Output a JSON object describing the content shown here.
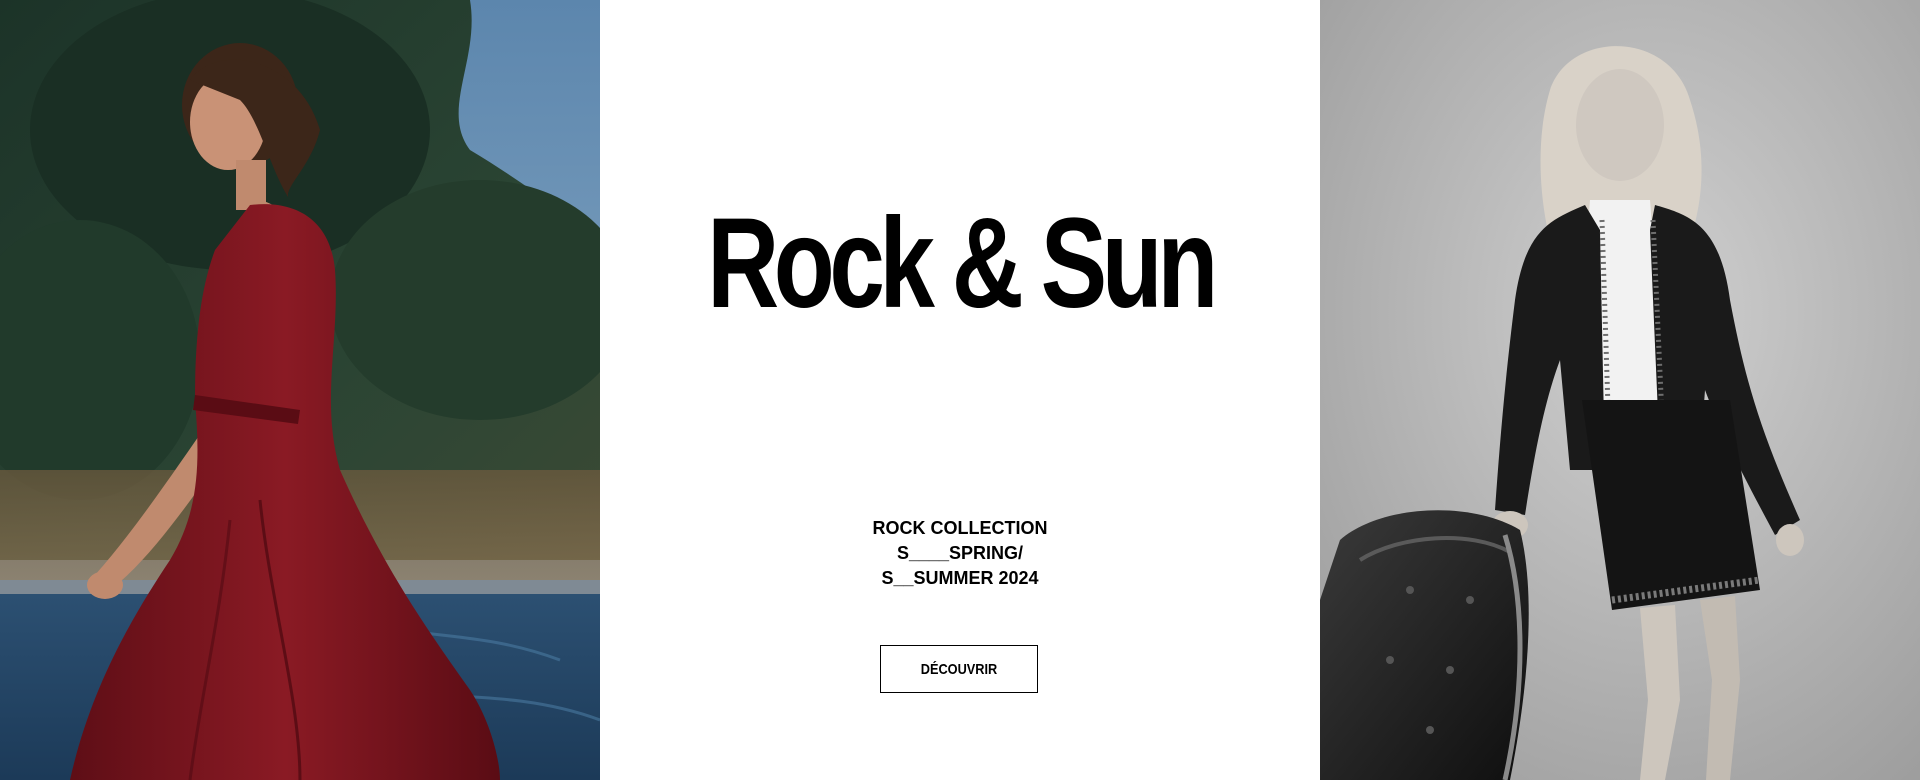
{
  "hero": {
    "title": "Rock & Sun",
    "collection_lines": [
      "ROCK COLLECTION",
      "S____SPRING/",
      "S__SUMMER 2024"
    ],
    "cta_label": "DÉCOUVRIR"
  },
  "images": {
    "left": "woman-in-red-dress-photo",
    "right": "woman-in-black-jacket-bw-photo"
  },
  "colors": {
    "background": "#ffffff",
    "text": "#000000",
    "dress": "#7e1520"
  }
}
